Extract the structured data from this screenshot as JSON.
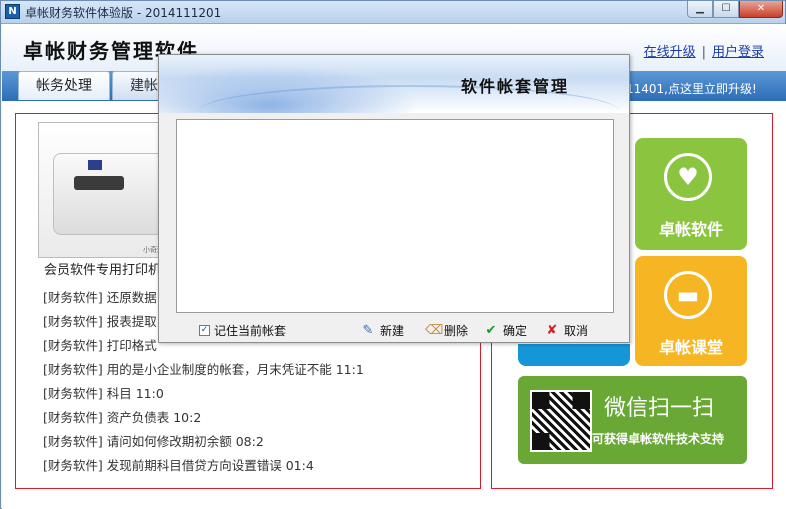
{
  "window": {
    "title": "卓帐财务软件体验版 - 2014111201",
    "app_icon": "N",
    "min_glyph": "▁",
    "max_glyph": "☐",
    "close_glyph": "✕"
  },
  "header": {
    "brand": "卓帐财务管理软件",
    "links": {
      "upgrade": "在线升级",
      "separator": "|",
      "login": "用户登录"
    }
  },
  "tabs": [
    {
      "label": "帐务处理"
    },
    {
      "label": "建帐向导"
    }
  ],
  "upgrade_notice": "11401,点这里立即升级!",
  "left_panel": {
    "printer_caption": "小奇测打印机",
    "product_label": "会员软件专用打印机",
    "news": [
      {
        "tag": "[财务软件]",
        "text": "还原数据"
      },
      {
        "tag": "[财务软件]",
        "text": "报表提取"
      },
      {
        "tag": "[财务软件]",
        "text": "打印格式"
      },
      {
        "tag": "[财务软件]",
        "text": "用的是小企业制度的帐套，月末凭证不能 11:1"
      },
      {
        "tag": "[财务软件]",
        "text": "科目 11:0"
      },
      {
        "tag": "[财务软件]",
        "text": "资产负债表 10:2"
      },
      {
        "tag": "[财务软件]",
        "text": "请问如何修改期初余额 08:2"
      },
      {
        "tag": "[财务软件]",
        "text": "发现前期科目借贷方向设置错误 01:4"
      }
    ]
  },
  "right_panel": {
    "tile_software": {
      "label": "卓帐软件",
      "icon": "heart-icon",
      "glyph": "♥",
      "color": "#8bc540"
    },
    "tile_class": {
      "label": "卓帐课堂",
      "icon": "folder-icon",
      "glyph": "▬",
      "color": "#f6b523"
    },
    "wechat": {
      "title": "微信扫一扫",
      "subtitle": "可获得卓帐软件技术支持",
      "color": "#6aa836"
    }
  },
  "modal": {
    "title": "软件帐套管理",
    "remember_label": "记住当前帐套",
    "remember_checked": true,
    "check_glyph": "✓",
    "buttons": {
      "new": "新建",
      "delete": "删除",
      "ok": "确定",
      "cancel": "取消"
    },
    "icons": {
      "new_glyph": "✎",
      "delete_glyph": "⌫",
      "ok_glyph": "✔",
      "cancel_glyph": "✘"
    }
  }
}
